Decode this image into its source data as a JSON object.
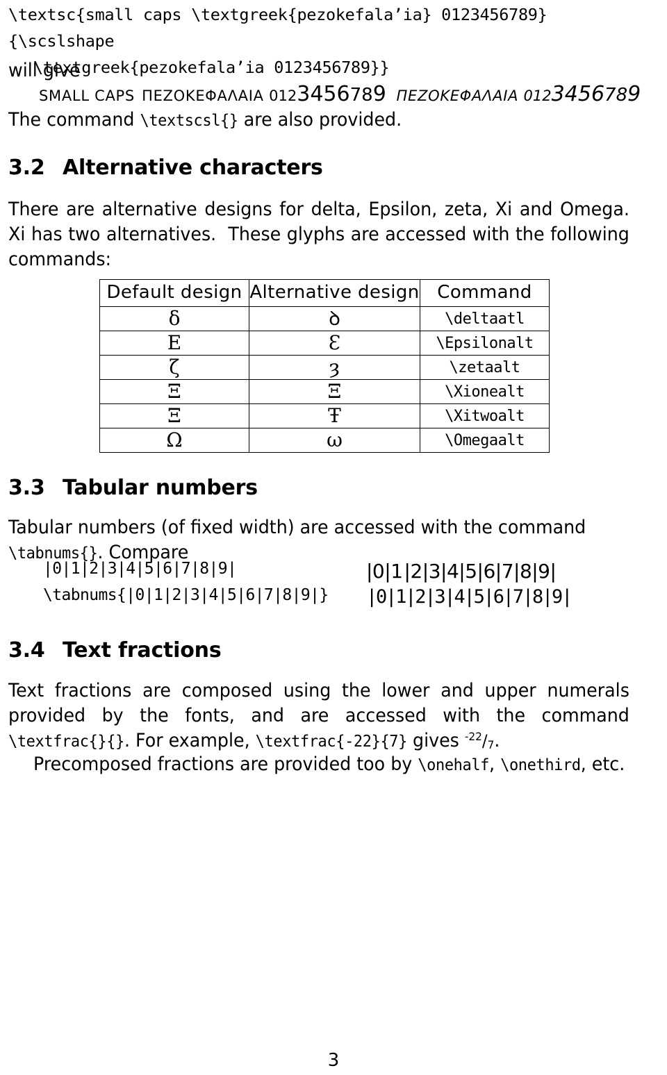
{
  "document": {
    "page_number": "3"
  },
  "code_listing": {
    "line1": "\\textsc{small caps \\textgreek{pezokefala’ia} 0123456789} {\\scslshape",
    "line2": "\\textgreek{pezokefala’ia 0123456789}}"
  },
  "will_give": {
    "label": "will give"
  },
  "smallcaps_sample": {
    "upright_latin": "SMALL CAPS",
    "upright_greek": "ΠΕΖΟΚΕΦΑΛΑΙΑ",
    "upright_digits": "0123456789",
    "slanted_greek": "ΠΕΖΟΚΕΦΑΛΑΙΑ",
    "slanted_digits": "0123456789"
  },
  "textscsl_note": {
    "before": "The command ",
    "command": "\\textscsl{}",
    "after": " are also provided."
  },
  "sections": {
    "alternative_characters": {
      "number": "3.2",
      "title": "Alternative characters",
      "paragraph_part1": "There are alternative designs for delta, Epsilon, zeta, Xi and Omega. Xi has two alternatives.  These glyphs are accessed with the following commands:"
    },
    "tabular_numbers": {
      "number": "3.3",
      "title": "Tabular numbers",
      "paragraph_before": "Tabular numbers (of fixed width) are accessed with the command ",
      "paragraph_command": "\\tabnums{}",
      "paragraph_after": ". Compare"
    },
    "text_fractions": {
      "number": "3.4",
      "title": "Text fractions",
      "p1_a": "Text fractions are composed using the lower and upper numerals provided by the fonts, and are accessed with the command ",
      "p1_cmd1": "\\textfrac{}{}",
      "p1_b": ". For example, ",
      "p1_cmd2": "\\textfrac{-22}{7}",
      "p1_c": " gives ",
      "p1_frac_numerator": "-22",
      "p1_frac_slash": "/",
      "p1_frac_denominator": "7",
      "p1_d": ".",
      "p2_a": "Precomposed fractions are provided too by ",
      "p2_cmd1": "\\onehalf",
      "p2_b": ", ",
      "p2_cmd2": "\\onethird",
      "p2_c": ", etc."
    }
  },
  "glyph_table": {
    "headers": [
      "Default design",
      "Alternative design",
      "Command"
    ],
    "rows": [
      {
        "default": "δ",
        "alternative": "ꝺ",
        "command": "\\deltaatl"
      },
      {
        "default": "E",
        "alternative": "Ɛ",
        "command": "\\Epsilonalt"
      },
      {
        "default": "ζ",
        "alternative": "ȝ",
        "command": "\\zetaalt"
      },
      {
        "default": "Ξ",
        "alternative": "Ξ",
        "command": "\\Xionealt"
      },
      {
        "default": "Ξ",
        "alternative": "Ŧ",
        "command": "\\Xitwoalt"
      },
      {
        "default": "Ω",
        "alternative": "ω",
        "command": "\\Omegaalt"
      }
    ]
  },
  "number_demo": {
    "row1_source": "|0|1|2|3|4|5|6|7|8|9|",
    "row1_result": "|0|1|2|3|4|5|6|7|8|9|",
    "row2_source": "\\tabnums{|0|1|2|3|4|5|6|7|8|9|}",
    "row2_result": "|0|1|2|3|4|5|6|7|8|9|"
  }
}
